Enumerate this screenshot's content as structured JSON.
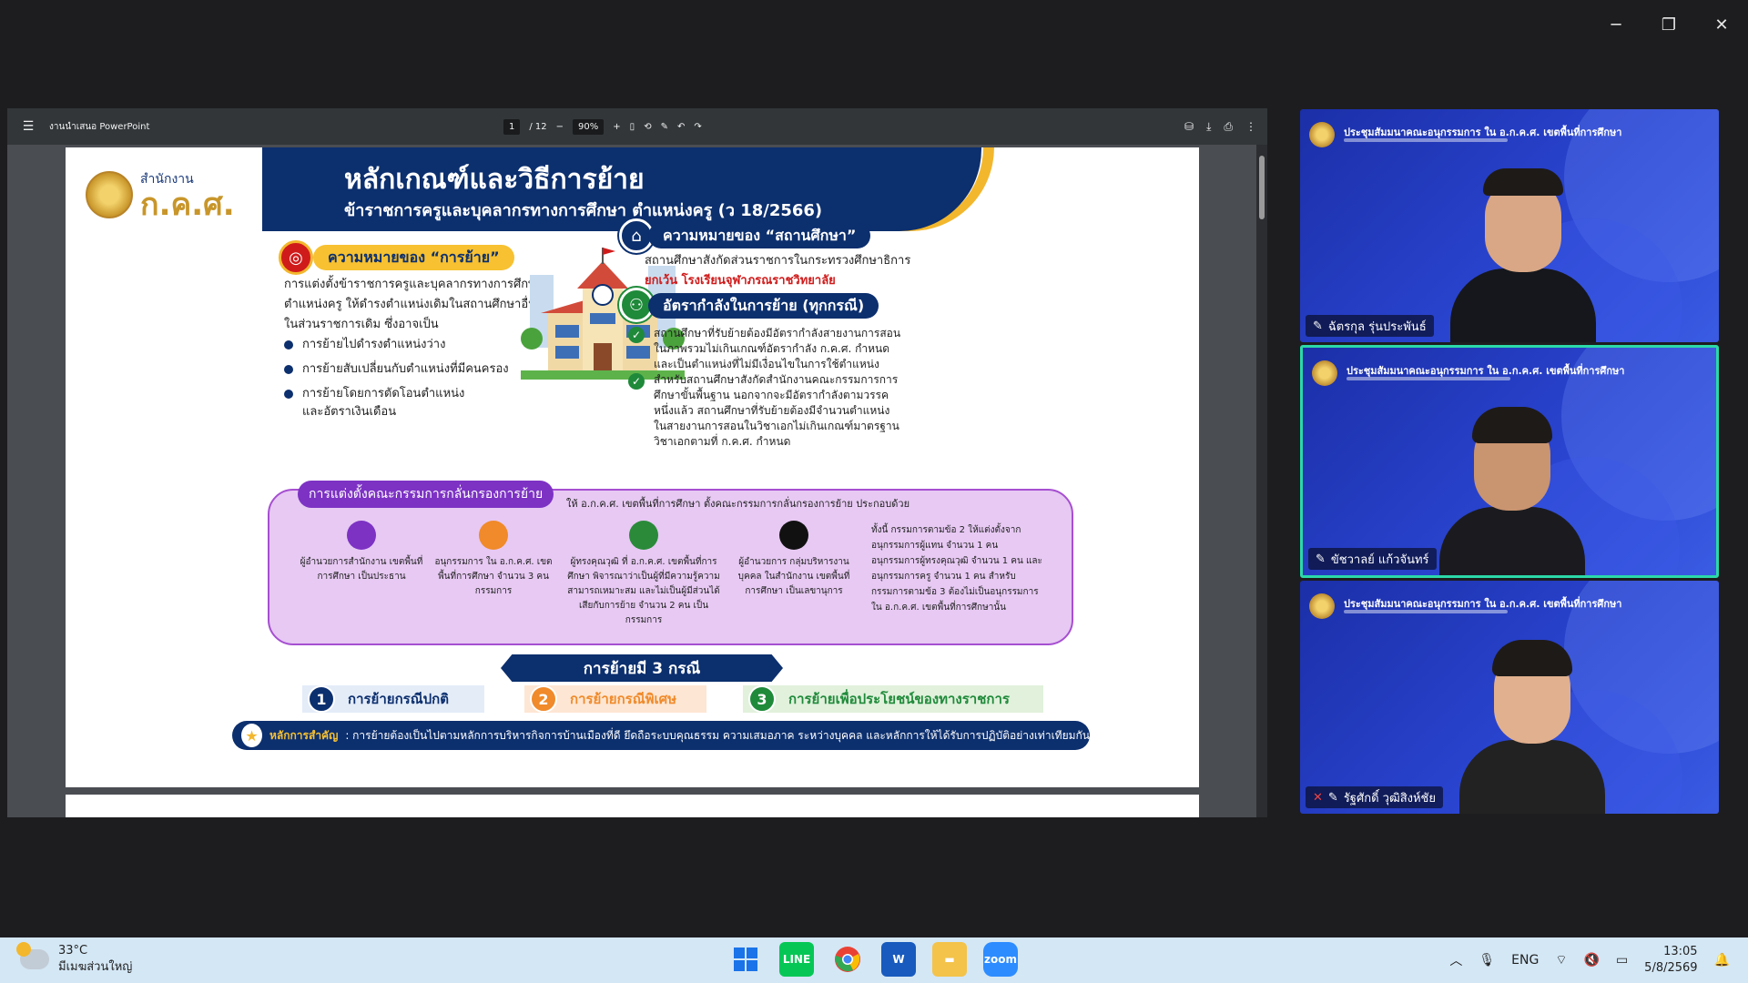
{
  "window_controls": {
    "minimize": "─",
    "restore": "❐",
    "close": "✕"
  },
  "viewer": {
    "title": "งานนำเสนอ PowerPoint",
    "page_current": "1",
    "page_total": "/ 12",
    "zoom": "90%",
    "zoom_out": "−",
    "zoom_in": "+"
  },
  "slide": {
    "logo_sub": "สำนักงาน",
    "logo_main": "ก.ค.ศ.",
    "title": "หลักเกณฑ์และวิธีการย้าย",
    "subtitle": "ข้าราชการครูและบุคลากรทางการศึกษา ตำแหน่งครู (ว 18/2566)",
    "meaning_move": {
      "heading": "ความหมายของ “การย้าย”",
      "text": "การแต่งตั้งข้าราชการครูและบุคลากรทางการศึกษาตำแหน่งครู ให้ดำรงตำแหน่งเดิมในสถานศึกษาอื่นในส่วนราชการเดิม ซึ่งอาจเป็น",
      "bullets": [
        "การย้ายไปดำรงตำแหน่งว่าง",
        "การย้ายสับเปลี่ยนกับตำแหน่งที่มีคนครอง",
        "การย้ายโดยการตัดโอนตำแหน่งและอัตราเงินเดือน"
      ]
    },
    "meaning_school": {
      "heading": "ความหมายของ “สถานศึกษา”",
      "text": "สถานศึกษาสังกัดส่วนราชการในกระทรวงศึกษาธิการ",
      "except": "ยกเว้น โรงเรียนจุฬาภรณราชวิทยาลัย"
    },
    "staffing": {
      "heading": "อัตรากำลังในการย้าย (ทุกกรณี)",
      "items": [
        "สถานศึกษาที่รับย้ายต้องมีอัตรากำลังสายงานการสอนในภาพรวมไม่เกินเกณฑ์อัตรากำลัง ก.ค.ศ. กำหนด และเป็นตำแหน่งที่ไม่มีเงื่อนไขในการใช้ตำแหน่ง",
        "สำหรับสถานศึกษาสังกัดสำนักงานคณะกรรมการการศึกษาขั้นพื้นฐาน นอกจากจะมีอัตรากำลังตามวรรคหนึ่งแล้ว สถานศึกษาที่รับย้ายต้องมีจำนวนตำแหน่งในสายงานการสอนในวิชาเอกไม่เกินเกณฑ์มาตรฐานวิชาเอกตามที่ ก.ค.ศ. กำหนด"
      ]
    },
    "committee": {
      "heading": "การแต่งตั้งคณะกรรมการกลั่นกรองการย้าย",
      "intro": "ให้ อ.ก.ค.ศ. เขตพื้นที่การศึกษา ตั้งคณะกรรมการกลั่นกรองการย้าย ประกอบด้วย",
      "members": [
        "ผู้อำนวยการสำนักงาน เขตพื้นที่การศึกษา เป็นประธาน",
        "อนุกรรมการ ใน อ.ก.ค.ศ. เขตพื้นที่การศึกษา จำนวน 3 คน กรรมการ",
        "ผู้ทรงคุณวุฒิ ที่ อ.ก.ค.ศ. เขตพื้นที่การศึกษา พิจารณาว่าเป็นผู้ที่มีความรู้ความสามารถเหมาะสม และไม่เป็นผู้มีส่วนได้เสียกับการย้าย จำนวน 2 คน เป็นกรรมการ",
        "ผู้อำนวยการ กลุ่มบริหารงานบุคคล ในสำนักงาน เขตพื้นที่การศึกษา เป็นเลขานุการ"
      ],
      "note": "ทั้งนี้ กรรมการตามข้อ 2 ให้แต่งตั้งจาก อนุกรรมการผู้แทน จำนวน 1 คน อนุกรรมการผู้ทรงคุณวุฒิ จำนวน 1 คน และอนุกรรมการครู จำนวน 1 คน สำหรับกรรมการตามข้อ 3 ต้องไม่เป็นอนุกรรมการใน อ.ก.ค.ศ. เขตพื้นที่การศึกษานั้น"
    },
    "cases": {
      "title": "การย้ายมี 3 กรณี",
      "items": [
        {
          "num": "1",
          "label": "การย้ายกรณีปกติ"
        },
        {
          "num": "2",
          "label": "การย้ายกรณีพิเศษ"
        },
        {
          "num": "3",
          "label": "การย้ายเพื่อประโยชน์ของทางราชการ"
        }
      ]
    },
    "principle": {
      "label": "หลักการสำคัญ",
      "text": ": การย้ายต้องเป็นไปตามหลักการบริหารกิจการบ้านเมืองที่ดี ยึดถือระบบคุณธรรม ความเสมอภาค ระหว่างบุคคล และหลักการให้ได้รับการปฏิบัติอย่างเท่าเทียมกัน"
    }
  },
  "participants": [
    {
      "caption": "ประชุมสัมมนาคณะอนุกรรมการ ใน อ.ก.ค.ศ. เขตพื้นที่การศึกษา",
      "name": "ฉัตรกุล รุ่นประพันธ์",
      "active": false,
      "muted": false
    },
    {
      "caption": "ประชุมสัมมนาคณะอนุกรรมการ ใน อ.ก.ค.ศ. เขตพื้นที่การศึกษา",
      "name": "ขัชวาลย์ แก้วจันทร์",
      "active": true,
      "muted": false
    },
    {
      "caption": "ประชุมสัมมนาคณะอนุกรรมการ ใน อ.ก.ค.ศ. เขตพื้นที่การศึกษา",
      "name": "รัฐศักดิ์ วุฒิสิงห์ชัย",
      "active": false,
      "muted": true
    }
  ],
  "taskbar": {
    "temperature": "33°C",
    "weather": "มีเมฆส่วนใหญ่",
    "apps": [
      "windows-start",
      "line",
      "chrome",
      "word",
      "file-explorer",
      "zoom"
    ],
    "language": "ENG",
    "time": "13:05",
    "date": "5/8/2569"
  },
  "colors": {
    "navy": "#0c2f6e",
    "gold": "#f3b72d",
    "purple": "#7d32c4",
    "tile_blue": "#2a45d1",
    "active_border": "#2bd9a8"
  }
}
